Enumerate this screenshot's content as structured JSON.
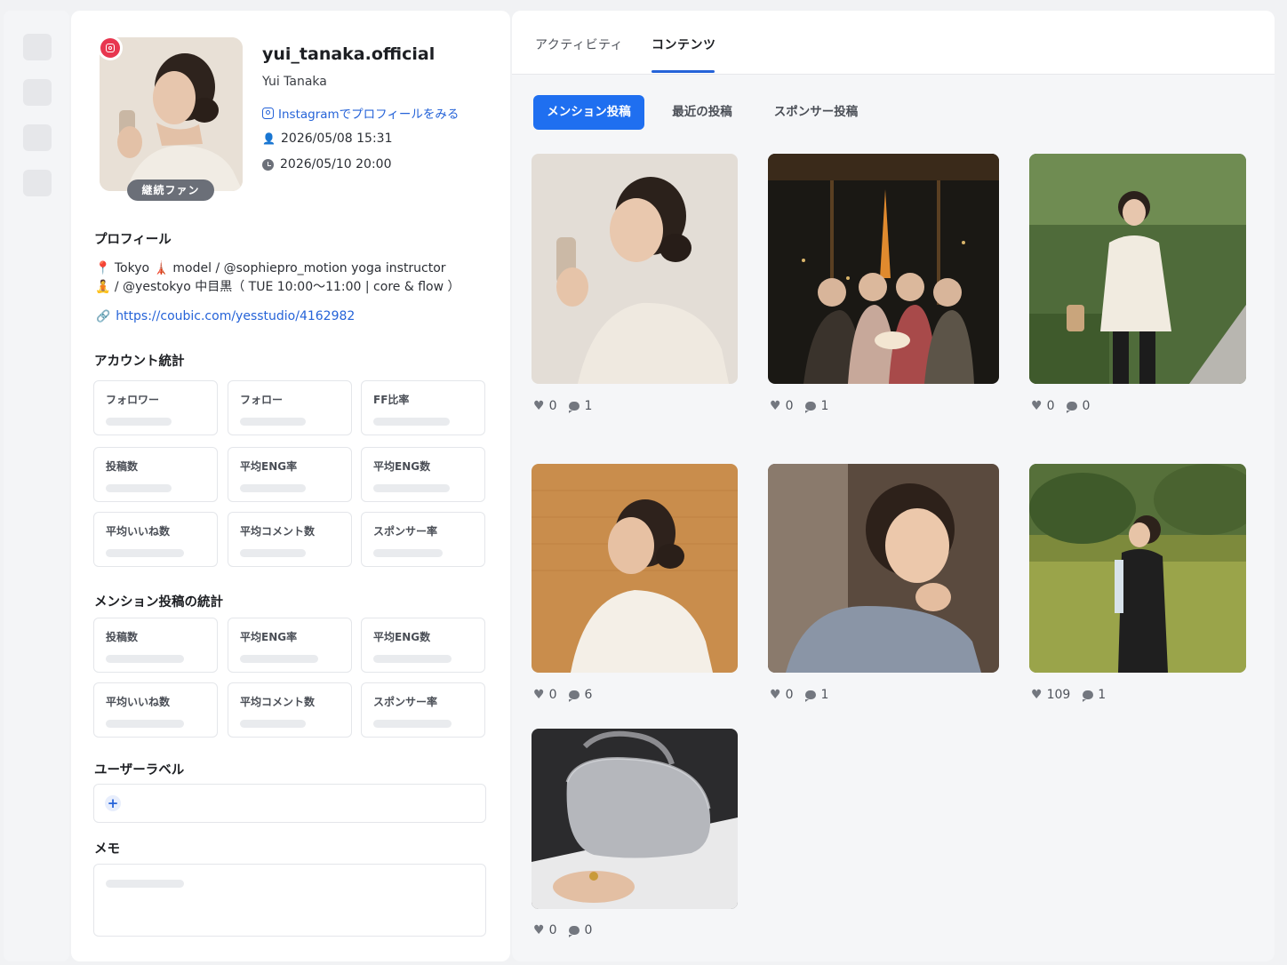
{
  "profile": {
    "username": "yui_tanaka.official",
    "display_name": "Yui Tanaka",
    "ig_link_text": "Instagramでプロフィールをみる",
    "registered_at": "2026/05/08 15:31",
    "updated_at": "2026/05/10 20:00",
    "fan_badge": "継続ファン"
  },
  "sections": {
    "profile_title": "プロフィール",
    "account_stats_title": "アカウント統計",
    "mention_stats_title": "メンション投稿の統計",
    "user_label_title": "ユーザーラベル",
    "memo_title": "メモ"
  },
  "bio": {
    "line1": "📍 Tokyo 🗼 model / @sophiepro_motion yoga instructor",
    "line2": "🧘 / @yestokyo 中目黒（ TUE 10:00〜11:00 | core & flow ）",
    "link": "https://coubic.com/yesstudio/4162982"
  },
  "account_stats": [
    "フォロワー",
    "フォロー",
    "FF比率",
    "投稿数",
    "平均ENG率",
    "平均ENG数",
    "平均いいね数",
    "平均コメント数",
    "スポンサー率"
  ],
  "mention_stats": [
    "投稿数",
    "平均ENG率",
    "平均ENG数",
    "平均いいね数",
    "平均コメント数",
    "スポンサー率"
  ],
  "tabs": [
    "アクティビティ",
    "コンテンツ"
  ],
  "filters": [
    "メンション投稿",
    "最近の投稿",
    "スポンサー投稿"
  ],
  "posts": [
    {
      "likes": "0",
      "comments": "1"
    },
    {
      "likes": "0",
      "comments": "1"
    },
    {
      "likes": "0",
      "comments": "0"
    },
    {
      "likes": "0",
      "comments": "6"
    },
    {
      "likes": "0",
      "comments": "1"
    },
    {
      "likes": "109",
      "comments": "1"
    },
    {
      "likes": "0",
      "comments": "0"
    }
  ],
  "colors": {
    "accent": "#1f6ff0",
    "link": "#2563d8",
    "ig": "#e8364f"
  }
}
